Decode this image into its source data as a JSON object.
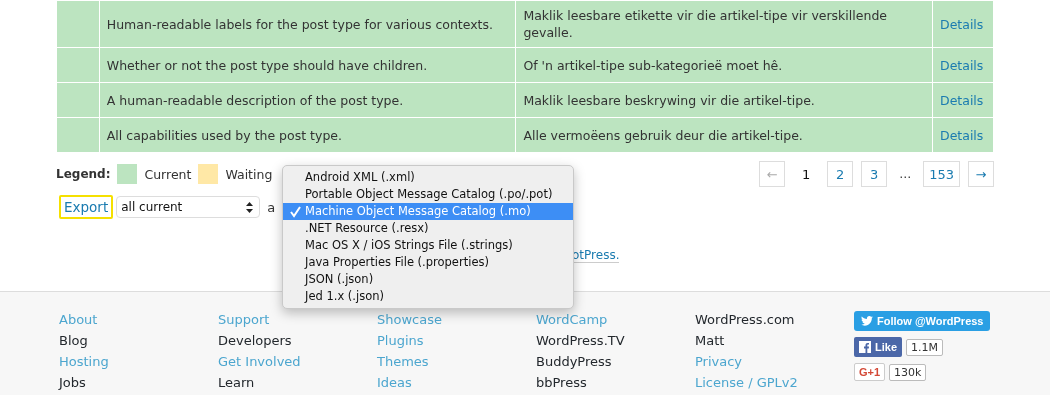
{
  "table": {
    "rows": [
      {
        "original": "Human-readable labels for the post type for various contexts.",
        "translation": "Maklik leesbare etikette vir die artikel-tipe vir verskillende gevalle.",
        "action": "Details"
      },
      {
        "original": "Whether or not the post type should have children.",
        "translation": "Of 'n artikel-tipe sub-kategorieë moet hê.",
        "action": "Details"
      },
      {
        "original": "A human-readable description of the post type.",
        "translation": "Maklik leesbare beskrywing vir die artikel-tipe.",
        "action": "Details"
      },
      {
        "original": "All capabilities used by the post type.",
        "translation": "Alle vermoëens gebruik deur die artikel-tipe.",
        "action": "Details"
      }
    ]
  },
  "legend": {
    "label": "Legend:",
    "items": [
      {
        "label": "Current",
        "color": "#bce4c0"
      },
      {
        "label": "Waiting",
        "color": "#ffe8a6"
      }
    ]
  },
  "pagination": {
    "prev": {
      "label": "←",
      "disabled": true
    },
    "next": {
      "label": "→",
      "disabled": false
    },
    "pages": [
      {
        "kind": "page",
        "label": "1",
        "selected": true
      },
      {
        "kind": "page",
        "label": "2",
        "selected": false
      },
      {
        "kind": "page",
        "label": "3",
        "selected": false
      },
      {
        "kind": "gap",
        "label": "…"
      },
      {
        "kind": "page",
        "label": "153",
        "selected": false
      }
    ]
  },
  "export": {
    "button": {
      "label": "Export",
      "focused": true
    },
    "scope": "all current",
    "as_text": "a",
    "format_menu": [
      {
        "label": "Android XML (.xml)",
        "selected": false
      },
      {
        "label": "Portable Object Message Catalog (.po/.pot)",
        "selected": false
      },
      {
        "label": "Machine Object Message Catalog (.mo)",
        "selected": true
      },
      {
        "label": ".NET Resource (.resx)",
        "selected": false
      },
      {
        "label": "Mac OS X / iOS Strings File (.strings)",
        "selected": false
      },
      {
        "label": "Java Properties File (.properties)",
        "selected": false
      },
      {
        "label": "JSON (.json)",
        "selected": false
      },
      {
        "label": "Jed 1.x (.json)",
        "selected": false
      }
    ]
  },
  "credit": "otPress.",
  "footer": {
    "columns": [
      [
        {
          "label": "About",
          "visited": false
        },
        {
          "label": "Blog",
          "visited": true
        },
        {
          "label": "Hosting",
          "visited": false
        },
        {
          "label": "Jobs",
          "visited": true
        }
      ],
      [
        {
          "label": "Support",
          "visited": false
        },
        {
          "label": "Developers",
          "visited": true
        },
        {
          "label": "Get Involved",
          "visited": false
        },
        {
          "label": "Learn",
          "visited": true
        }
      ],
      [
        {
          "label": "Showcase",
          "visited": false
        },
        {
          "label": "Plugins",
          "visited": false
        },
        {
          "label": "Themes",
          "visited": false
        },
        {
          "label": "Ideas",
          "visited": false
        }
      ],
      [
        {
          "label": "WordCamp",
          "visited": false
        },
        {
          "label": "WordPress.TV",
          "visited": true
        },
        {
          "label": "BuddyPress",
          "visited": true
        },
        {
          "label": "bbPress",
          "visited": true
        }
      ],
      [
        {
          "label": "WordPress.com",
          "visited": true
        },
        {
          "label": "Matt",
          "visited": true
        },
        {
          "label": "Privacy",
          "visited": false
        },
        {
          "label": "License / GPLv2",
          "visited": false
        }
      ]
    ],
    "social": {
      "follow": "Follow @WordPress",
      "like": "Like",
      "like_count": "1.1M",
      "plus": "G+1",
      "plus_count": "130k"
    }
  }
}
